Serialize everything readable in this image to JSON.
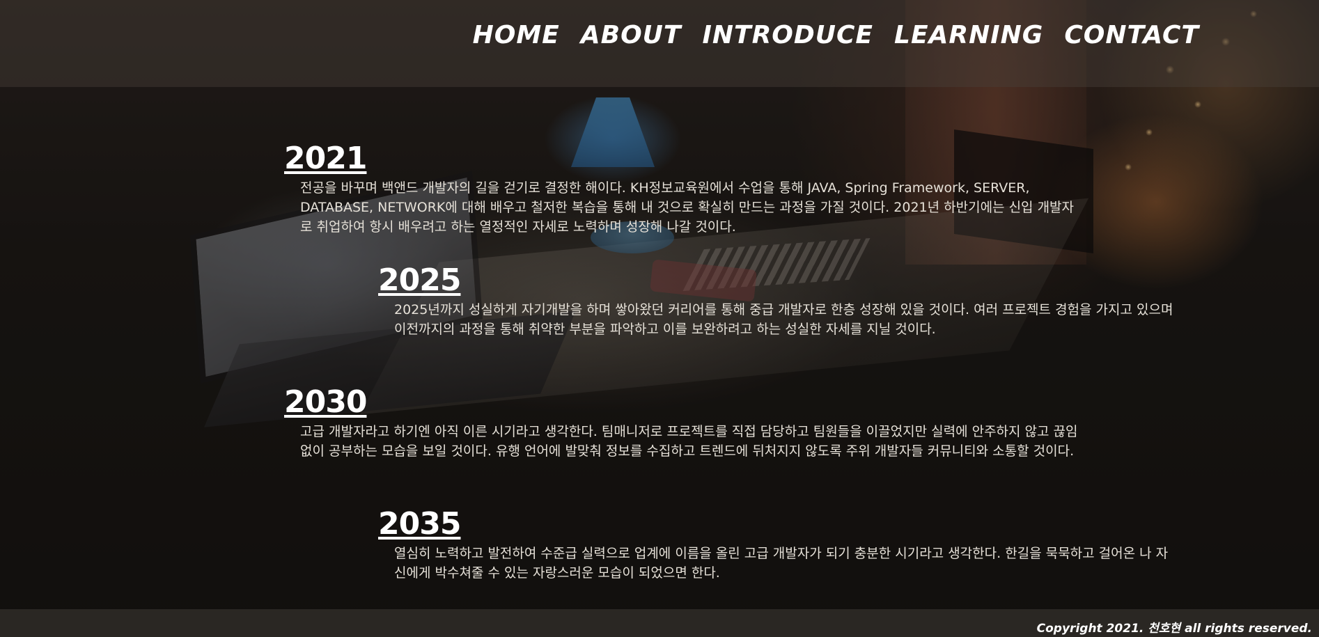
{
  "nav": {
    "items": [
      {
        "label": "HOME"
      },
      {
        "label": "ABOUT"
      },
      {
        "label": "INTRODUCE"
      },
      {
        "label": "LEARNING"
      },
      {
        "label": "CONTACT"
      }
    ]
  },
  "timeline": [
    {
      "year": "2021",
      "text": "전공을 바꾸며 백앤드 개발자의 길을 걷기로 결정한 해이다. KH정보교육원에서 수업을 통해 JAVA, Spring Framework, SERVER, DATABASE, NETWORK에 대해 배우고 철저한 복습을 통해 내 것으로 확실히 만드는 과정을 가질 것이다. 2021년 하반기에는 신입 개발자로 취업하여 항시 배우려고 하는 열정적인 자세로 노력하며 성장해 나갈 것이다."
    },
    {
      "year": "2025",
      "text": "2025년까지 성실하게 자기개발을 하며 쌓아왔던 커리어를 통해 중급 개발자로 한층 성장해 있을 것이다. 여러 프로젝트 경험을 가지고 있으며 이전까지의 과정을 통해 취약한 부분을 파악하고 이를 보완하려고 하는 성실한 자세를 지닐 것이다."
    },
    {
      "year": "2030",
      "text": "고급 개발자라고 하기엔 아직 이른 시기라고 생각한다. 팀매니저로 프로젝트를 직접 담당하고 팀원들을 이끌었지만 실력에 안주하지 않고 끊임없이 공부하는 모습을 보일 것이다. 유행 언어에 발맞춰 정보를 수집하고 트렌드에 뒤처지지 않도록 주위 개발자들 커뮤니티와 소통할 것이다."
    },
    {
      "year": "2035",
      "text": "열심히 노력하고 발전하여 수준급 실력으로 업계에 이름을 올린 고급 개발자가 되기 충분한 시기라고 생각한다. 한길을 묵묵하고 걸어온 나 자신에게 박수쳐줄 수 있는 자랑스러운 모습이 되었으면 한다."
    }
  ],
  "footer": {
    "copyright": "Copyright 2021. 천호현 all rights reserved."
  },
  "colors": {
    "text": "#ffffff",
    "body_text": "#e6e1d8",
    "header_bg": "rgba(70,62,56,0.45)",
    "page_bg": "#14110e"
  }
}
